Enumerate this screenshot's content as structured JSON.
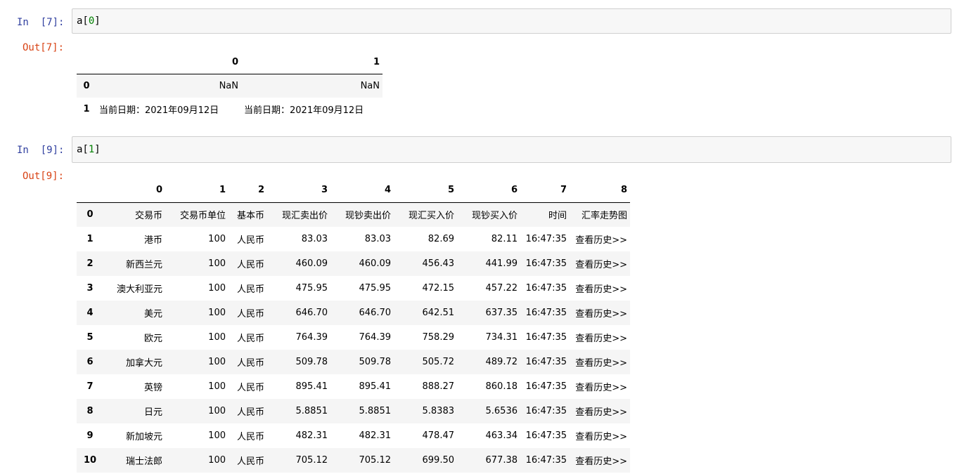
{
  "cells": [
    {
      "in_prompt": "In  [7]:",
      "code": "a[0]",
      "out_prompt": "Out[7]:",
      "table": {
        "columns": [
          "",
          "0",
          "1"
        ],
        "rows": [
          [
            "0",
            "NaN",
            "NaN"
          ],
          [
            "1",
            "当前日期：2021年09月12日",
            "当前日期：2021年09月12日"
          ]
        ]
      }
    },
    {
      "in_prompt": "In  [9]:",
      "code": "a[1]",
      "out_prompt": "Out[9]:",
      "table": {
        "columns": [
          "",
          "0",
          "1",
          "2",
          "3",
          "4",
          "5",
          "6",
          "7",
          "8"
        ],
        "rows": [
          [
            "0",
            "交易币",
            "交易币单位",
            "基本币",
            "现汇卖出价",
            "现钞卖出价",
            "现汇买入价",
            "现钞买入价",
            "时间",
            "汇率走势图"
          ],
          [
            "1",
            "港币",
            "100",
            "人民币",
            "83.03",
            "83.03",
            "82.69",
            "82.11",
            "16:47:35",
            "查看历史>>"
          ],
          [
            "2",
            "新西兰元",
            "100",
            "人民币",
            "460.09",
            "460.09",
            "456.43",
            "441.99",
            "16:47:35",
            "查看历史>>"
          ],
          [
            "3",
            "澳大利亚元",
            "100",
            "人民币",
            "475.95",
            "475.95",
            "472.15",
            "457.22",
            "16:47:35",
            "查看历史>>"
          ],
          [
            "4",
            "美元",
            "100",
            "人民币",
            "646.70",
            "646.70",
            "642.51",
            "637.35",
            "16:47:35",
            "查看历史>>"
          ],
          [
            "5",
            "欧元",
            "100",
            "人民币",
            "764.39",
            "764.39",
            "758.29",
            "734.31",
            "16:47:35",
            "查看历史>>"
          ],
          [
            "6",
            "加拿大元",
            "100",
            "人民币",
            "509.78",
            "509.78",
            "505.72",
            "489.72",
            "16:47:35",
            "查看历史>>"
          ],
          [
            "7",
            "英镑",
            "100",
            "人民币",
            "895.41",
            "895.41",
            "888.27",
            "860.18",
            "16:47:35",
            "查看历史>>"
          ],
          [
            "8",
            "日元",
            "100",
            "人民币",
            "5.8851",
            "5.8851",
            "5.8383",
            "5.6536",
            "16:47:35",
            "查看历史>>"
          ],
          [
            "9",
            "新加坡元",
            "100",
            "人民币",
            "482.31",
            "482.31",
            "478.47",
            "463.34",
            "16:47:35",
            "查看历史>>"
          ],
          [
            "10",
            "瑞士法郎",
            "100",
            "人民币",
            "705.12",
            "705.12",
            "699.50",
            "677.38",
            "16:47:35",
            "查看历史>>"
          ]
        ]
      }
    }
  ],
  "colors": {
    "in_prompt": "#303f9f",
    "out_prompt": "#d84315",
    "input_bg": "#f7f7f7",
    "input_border": "#cfcfcf",
    "stripe": "#f5f5f5",
    "code_number": "#008000"
  }
}
